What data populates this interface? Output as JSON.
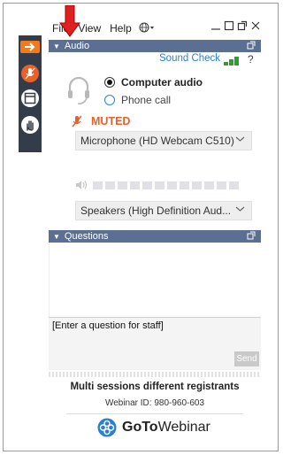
{
  "menu": {
    "file": "File",
    "view": "View",
    "help": "Help"
  },
  "audio": {
    "section_title": "Audio",
    "sound_check": "Sound Check",
    "help_symbol": "?",
    "computer_audio": "Computer audio",
    "phone_call": "Phone call",
    "muted": "MUTED",
    "microphone": "Microphone (HD Webcam C510)",
    "speakers": "Speakers (High Definition Aud..."
  },
  "questions": {
    "section_title": "Questions",
    "input_placeholder": "[Enter a question for staff]",
    "send": "Send"
  },
  "session": {
    "name": "Multi sessions different registrants",
    "webinar_id": "Webinar ID: 980-960-603"
  },
  "brand": {
    "go": "GoTo",
    "webinar": "Webinar"
  },
  "colors": {
    "accent_blue": "#2a82d7",
    "section_bar": "#5a6f91",
    "muted_orange": "#e8612a",
    "sidebar": "#333c48",
    "arrow_red": "#e02020"
  }
}
